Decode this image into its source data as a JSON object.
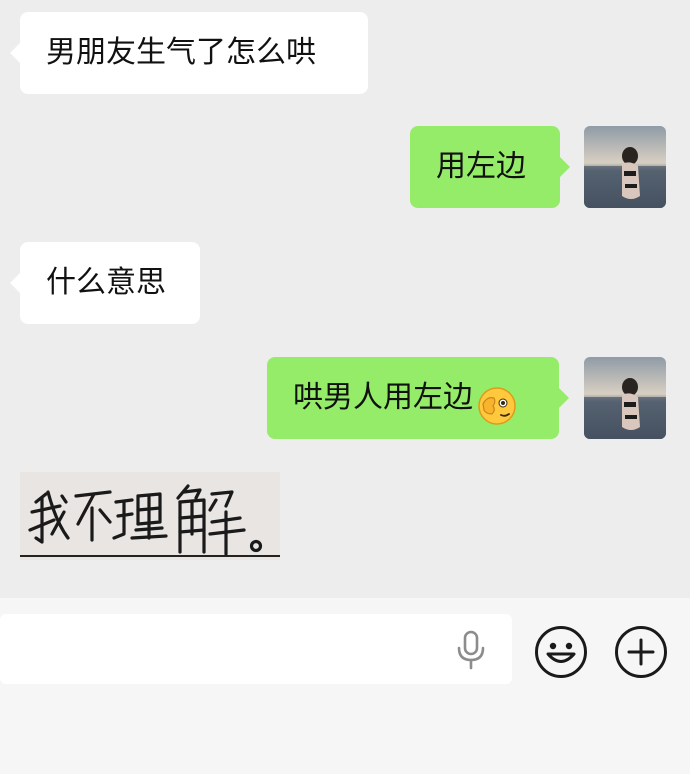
{
  "messages": [
    {
      "side": "in",
      "text": "男朋友生气了怎么哄"
    },
    {
      "side": "out",
      "text": "用左边"
    },
    {
      "side": "in",
      "text": "什么意思"
    },
    {
      "side": "out",
      "text": "哄男人用左边",
      "emoji": "face-peeking-hand-emoji"
    },
    {
      "side": "in",
      "type": "sticker",
      "text": "我不理解。"
    }
  ],
  "input": {
    "placeholder": "",
    "voice_icon": "microphone-icon",
    "emoji_icon": "smiley-face-icon",
    "more_icon": "plus-circle-icon"
  },
  "colors": {
    "background": "#ededed",
    "incoming_bubble": "#ffffff",
    "outgoing_bubble": "#95ec69",
    "input_bar": "#f6f6f6"
  }
}
